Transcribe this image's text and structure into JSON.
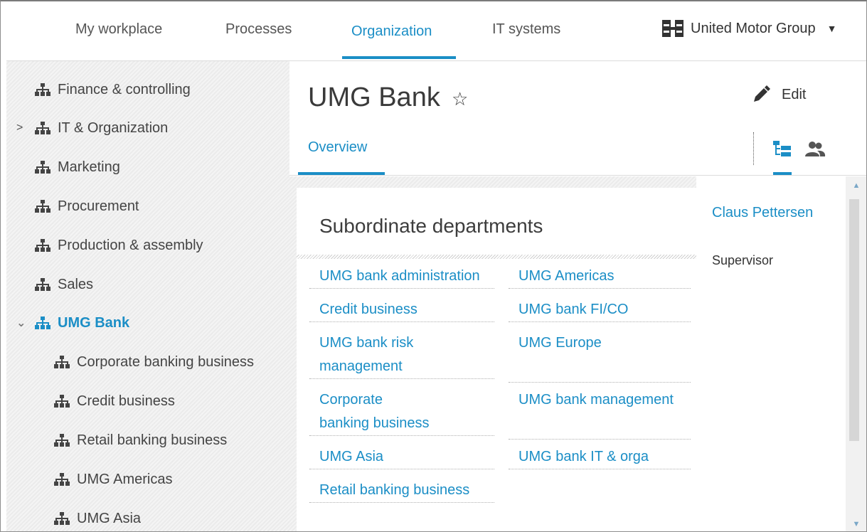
{
  "topnav": {
    "tabs": [
      {
        "label": "My workplace"
      },
      {
        "label": "Processes"
      },
      {
        "label": "Organization"
      },
      {
        "label": "IT systems"
      }
    ],
    "active_tab": "Organization",
    "company": "United Motor Group",
    "accent_color": "#1b8ec6"
  },
  "sidebar": {
    "items": [
      {
        "label": "Finance & controlling"
      },
      {
        "label": "IT & Organization"
      },
      {
        "label": "Marketing"
      },
      {
        "label": "Procurement"
      },
      {
        "label": "Production & assembly"
      },
      {
        "label": "Sales"
      },
      {
        "label": "UMG Bank"
      },
      {
        "label": "Corporate banking business"
      },
      {
        "label": "Credit business"
      },
      {
        "label": "Retail banking business"
      },
      {
        "label": "UMG Americas"
      },
      {
        "label": "UMG Asia"
      }
    ],
    "selected": "UMG Bank"
  },
  "header": {
    "title": "UMG Bank",
    "edit_label": "Edit",
    "subtab": "Overview"
  },
  "subordinate": {
    "title": "Subordinate departments",
    "left_column": [
      "UMG bank administration",
      "Credit business",
      "UMG bank risk management",
      "Corporate banking business",
      "UMG Asia",
      "Retail banking business"
    ],
    "right_column": [
      "UMG Americas",
      "UMG bank FI/CO",
      "UMG Europe",
      "UMG bank management",
      "UMG bank IT & orga"
    ]
  },
  "supervisor": {
    "name": "Claus Pettersen",
    "role": "Supervisor"
  }
}
